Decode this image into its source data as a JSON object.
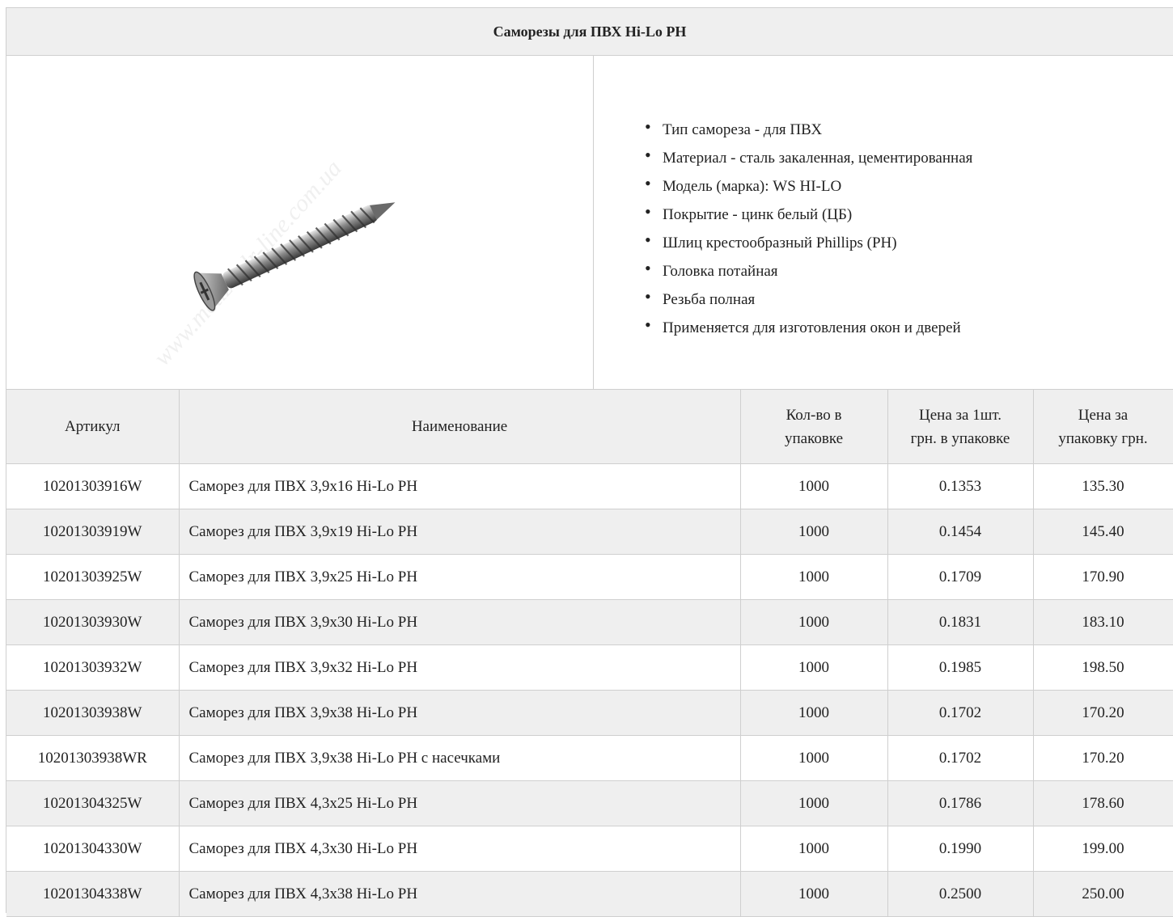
{
  "product": {
    "title": "Саморезы для ПВХ Hi-Lo PH",
    "image_watermark": "www.metiz-mlr-line.com.ua",
    "features": [
      "Тип самореза - для ПВХ",
      "Материал - сталь закаленная, цементированная",
      "Модель (марка): WS HI-LO",
      "Покрытие - цинк белый (ЦБ)",
      "Шлиц крестообразный Phillips (PH)",
      "Головка потайная",
      "Резьба полная",
      "Применяется для изготовления окон и дверей"
    ]
  },
  "table": {
    "headers": {
      "sku": "Артикул",
      "name": "Наименование",
      "qty_line1": "Кол-во в",
      "qty_line2": "упаковке",
      "unit_line1": "Цена за 1шт.",
      "unit_line2": "грн. в упаковке",
      "pack_line1": "Цена за",
      "pack_line2": "упаковку грн."
    },
    "rows": [
      {
        "sku": "10201303916W",
        "name": "Саморез для ПВХ 3,9x16 Hi-Lo PH",
        "qty": "1000",
        "unit_price": "0.1353",
        "pack_price": "135.30"
      },
      {
        "sku": "10201303919W",
        "name": "Саморез для ПВХ 3,9x19 Hi-Lo PH",
        "qty": "1000",
        "unit_price": "0.1454",
        "pack_price": "145.40"
      },
      {
        "sku": "10201303925W",
        "name": "Саморез для ПВХ 3,9x25 Hi-Lo PH",
        "qty": "1000",
        "unit_price": "0.1709",
        "pack_price": "170.90"
      },
      {
        "sku": "10201303930W",
        "name": "Саморез для ПВХ 3,9x30 Hi-Lo PH",
        "qty": "1000",
        "unit_price": "0.1831",
        "pack_price": "183.10"
      },
      {
        "sku": "10201303932W",
        "name": "Саморез для ПВХ 3,9x32 Hi-Lo PH",
        "qty": "1000",
        "unit_price": "0.1985",
        "pack_price": "198.50"
      },
      {
        "sku": "10201303938W",
        "name": "Саморез для ПВХ 3,9x38 Hi-Lo PH",
        "qty": "1000",
        "unit_price": "0.1702",
        "pack_price": "170.20"
      },
      {
        "sku": "10201303938WR",
        "name": "Саморез для ПВХ 3,9x38 Hi-Lo PH с насечками",
        "qty": "1000",
        "unit_price": "0.1702",
        "pack_price": "170.20"
      },
      {
        "sku": "10201304325W",
        "name": "Саморез для ПВХ 4,3x25 Hi-Lo PH",
        "qty": "1000",
        "unit_price": "0.1786",
        "pack_price": "178.60"
      },
      {
        "sku": "10201304330W",
        "name": "Саморез для ПВХ 4,3x30 Hi-Lo PH",
        "qty": "1000",
        "unit_price": "0.1990",
        "pack_price": "199.00"
      },
      {
        "sku": "10201304338W",
        "name": "Саморез для ПВХ 4,3x38 Hi-Lo PH",
        "qty": "1000",
        "unit_price": "0.2500",
        "pack_price": "250.00"
      }
    ]
  }
}
